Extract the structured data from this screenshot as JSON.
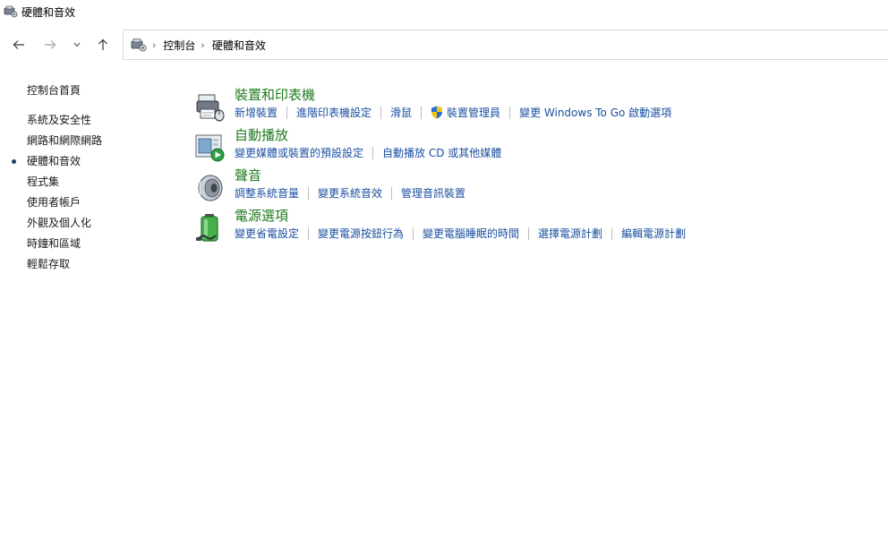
{
  "window": {
    "title": "硬體和音效"
  },
  "nav": {
    "back_glyph": "←",
    "forward_glyph": "→",
    "recent_glyph": "˅",
    "up_glyph": "↑"
  },
  "breadcrumb": {
    "separator": "›",
    "items": [
      "控制台",
      "硬體和音效"
    ]
  },
  "sidebar": {
    "items": [
      {
        "label": "控制台首頁"
      },
      {
        "label": "系統及安全性"
      },
      {
        "label": "網路和網際網路"
      },
      {
        "label": "硬體和音效",
        "current": true
      },
      {
        "label": "程式集"
      },
      {
        "label": "使用者帳戶"
      },
      {
        "label": "外觀及個人化"
      },
      {
        "label": "時鐘和區域"
      },
      {
        "label": "輕鬆存取"
      }
    ]
  },
  "categories": [
    {
      "title": "裝置和印表機",
      "icon": "printer-icon",
      "links": [
        "新增裝置",
        "進階印表機設定",
        "滑鼠",
        "裝置管理員",
        "變更 Windows To Go 啟動選項"
      ]
    },
    {
      "title": "自動播放",
      "icon": "autoplay-icon",
      "links": [
        "變更媒體或裝置的預設設定",
        "自動播放 CD 或其他媒體"
      ]
    },
    {
      "title": "聲音",
      "icon": "speaker-icon",
      "links": [
        "調整系統音量",
        "變更系統音效",
        "管理音訊裝置"
      ]
    },
    {
      "title": "電源選項",
      "icon": "battery-icon",
      "links": [
        "變更省電設定",
        "變更電源按鈕行為",
        "變更電腦睡眠的時間",
        "選擇電源計劃",
        "編輯電源計劃"
      ]
    }
  ],
  "colors": {
    "category_title": "#1e7a1e",
    "link": "#1a4fa0",
    "shield_blue": "#2a6fd1",
    "shield_yellow": "#f2c511"
  }
}
